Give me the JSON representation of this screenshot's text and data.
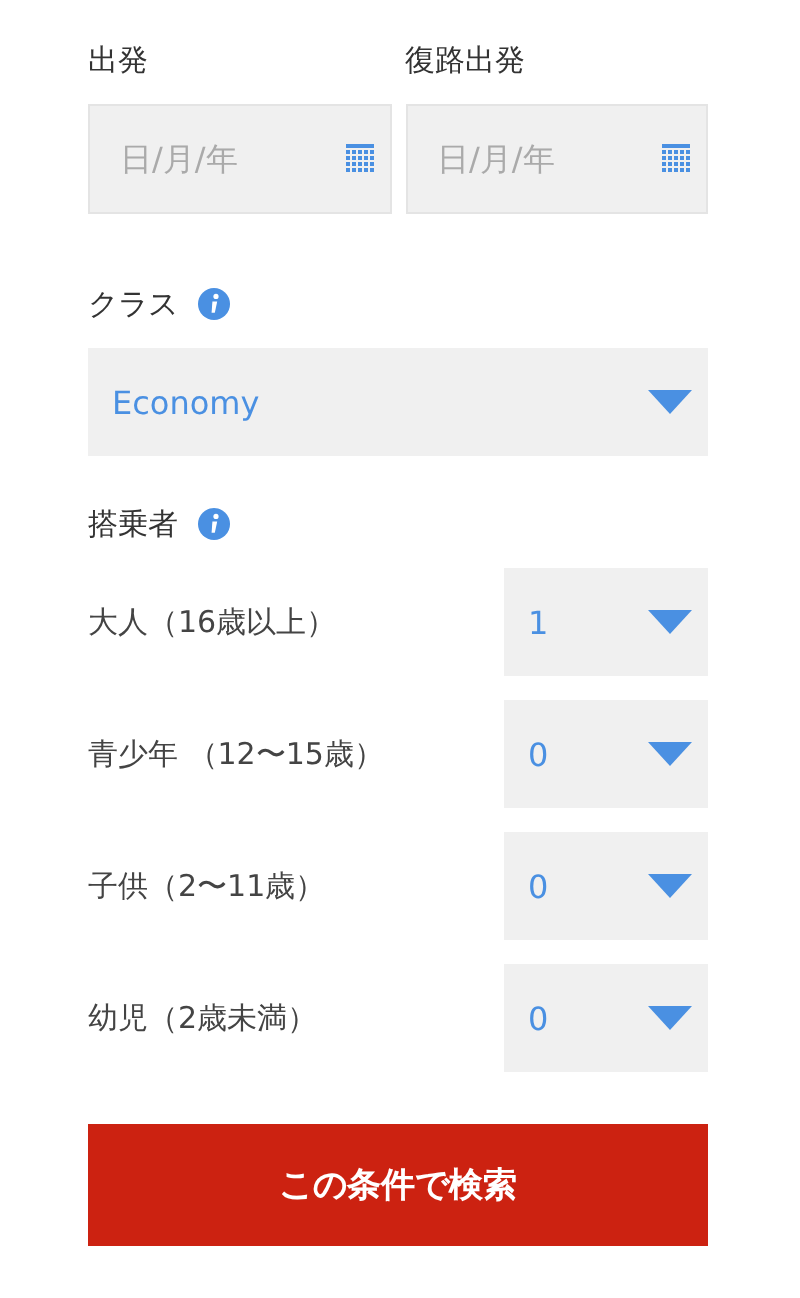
{
  "dates": [
    {
      "label": "出発",
      "placeholder": "日/月/年"
    },
    {
      "label": "復路出発",
      "placeholder": "日/月/年"
    }
  ],
  "cabin_class": {
    "label": "クラス",
    "value": "Economy"
  },
  "passengers": {
    "label": "搭乗者",
    "rows": [
      {
        "label": "大人（16歳以上）",
        "value": "1"
      },
      {
        "label": "青少年 （12〜15歳）",
        "value": "0"
      },
      {
        "label": "子供（2〜11歳）",
        "value": "0"
      },
      {
        "label": "幼児（2歳未満）",
        "value": "0"
      }
    ]
  },
  "search_button": "この条件で検索"
}
